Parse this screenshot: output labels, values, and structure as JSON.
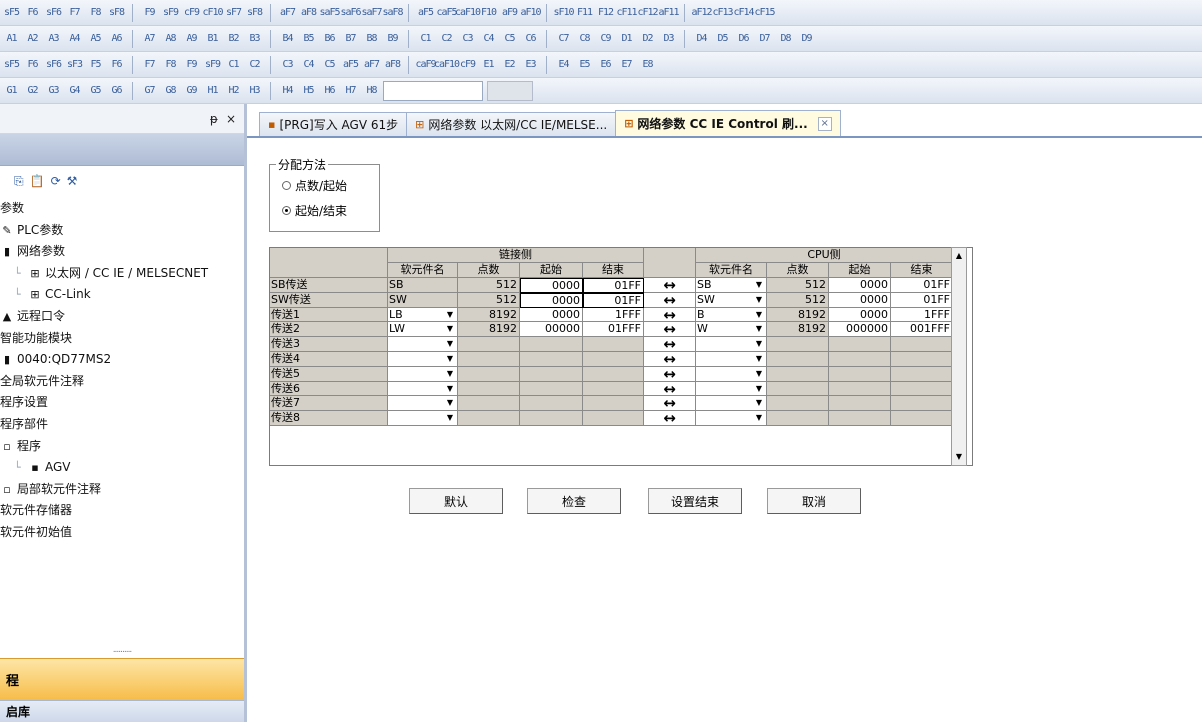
{
  "toolbar": {
    "rows": [
      [
        "sF5",
        "F6",
        "sF6",
        "F7",
        "F8",
        "sF8",
        "F9",
        "sF9",
        "cF9",
        "cF10",
        "sF7",
        "sF8",
        "aF7",
        "aF8",
        "saF5",
        "saF6",
        "saF7",
        "saF8",
        "aF5",
        "caF5",
        "caF10",
        "F10",
        "aF9",
        "aF10",
        "sF10",
        "F11",
        "F12",
        "cF11",
        "cF12",
        "aF11",
        "aF12",
        "cF13",
        "cF14",
        "cF15"
      ],
      [
        "A1",
        "A2",
        "A3",
        "A4",
        "A5",
        "A6",
        "A7",
        "A8",
        "A9",
        "B1",
        "B2",
        "B3",
        "B4",
        "B5",
        "B6",
        "B7",
        "B8",
        "B9",
        "C1",
        "C2",
        "C3",
        "C4",
        "C5",
        "C6",
        "C7",
        "C8",
        "C9",
        "D1",
        "D2",
        "D3",
        "D4",
        "D5",
        "D6",
        "D7",
        "D8",
        "D9"
      ],
      [
        "sF5",
        "F6",
        "sF6",
        "sF3",
        "F5",
        "F6",
        "F7",
        "F8",
        "F9",
        "sF9",
        "C1",
        "C2",
        "C3",
        "C4",
        "C5",
        "aF5",
        "aF7",
        "aF8",
        "caF9",
        "caF10",
        "cF9",
        "E1",
        "E2",
        "E3",
        "E4",
        "E5",
        "E6",
        "E7",
        "E8"
      ],
      [
        "G1",
        "G2",
        "G3",
        "G4",
        "G5",
        "G6",
        "G7",
        "G8",
        "G9",
        "H1",
        "H2",
        "H3",
        "H4",
        "H5",
        "H6",
        "H7",
        "H8"
      ]
    ]
  },
  "nav": {
    "pin": "ᵽ",
    "close": "×",
    "toolbar_icons": [
      "copy-icon",
      "paste-icon",
      "refresh-icon",
      "tools-icon"
    ],
    "items": [
      {
        "label": "参数",
        "indent": 0,
        "icon": ""
      },
      {
        "label": "PLC参数",
        "indent": 0,
        "icon": "✎"
      },
      {
        "label": "网络参数",
        "indent": 0,
        "icon": "▮"
      },
      {
        "label": "以太网 / CC IE / MELSECNET",
        "indent": 1,
        "icon": "⊞"
      },
      {
        "label": "CC-Link",
        "indent": 1,
        "icon": "⊞"
      },
      {
        "label": "远程口令",
        "indent": 0,
        "icon": "▲"
      },
      {
        "label": "智能功能模块",
        "indent": 0,
        "icon": ""
      },
      {
        "label": "0040:QD77MS2",
        "indent": 0,
        "icon": "▮"
      },
      {
        "label": "全局软元件注释",
        "indent": 0,
        "icon": ""
      },
      {
        "label": "程序设置",
        "indent": 0,
        "icon": ""
      },
      {
        "label": "程序部件",
        "indent": 0,
        "icon": ""
      },
      {
        "label": "程序",
        "indent": 0,
        "icon": "▫"
      },
      {
        "label": "AGV",
        "indent": 1,
        "icon": "▪"
      },
      {
        "label": "局部软元件注释",
        "indent": 0,
        "icon": "▫"
      },
      {
        "label": "软元件存储器",
        "indent": 0,
        "icon": ""
      },
      {
        "label": "软元件初始值",
        "indent": 0,
        "icon": ""
      }
    ],
    "splitter": "..........",
    "bottom_label": "程",
    "bottom_next_label": "启库"
  },
  "tabs": [
    {
      "icon": "▪",
      "label": "[PRG]写入 AGV 61步",
      "active": false
    },
    {
      "icon": "⊞",
      "label": "网络参数 以太网/CC IE/MELSE...",
      "active": false
    },
    {
      "icon": "⊞",
      "label": "网络参数 CC IE Control 刷...",
      "active": true,
      "close": "×"
    }
  ],
  "alloc": {
    "legend": "分配方法",
    "options": [
      {
        "label": "点数/起始",
        "selected": false
      },
      {
        "label": "起始/结束",
        "selected": true
      }
    ]
  },
  "grid": {
    "link_side": "链接侧",
    "cpu_side": "CPU侧",
    "col_headers": [
      "软元件名",
      "点数",
      "起始",
      "结束"
    ],
    "rows": [
      {
        "name": "SB传送",
        "link": [
          "SB",
          "512",
          "0000",
          "01FF"
        ],
        "cpu": [
          "SB",
          "512",
          "0000",
          "01FF"
        ]
      },
      {
        "name": "SW传送",
        "link": [
          "SW",
          "512",
          "0000",
          "01FF"
        ],
        "cpu": [
          "SW",
          "512",
          "0000",
          "01FF"
        ]
      },
      {
        "name": "传送1",
        "link": [
          "LB",
          "8192",
          "0000",
          "1FFF"
        ],
        "cpu": [
          "B",
          "8192",
          "0000",
          "1FFF"
        ]
      },
      {
        "name": "传送2",
        "link": [
          "LW",
          "8192",
          "00000",
          "01FFF"
        ],
        "cpu": [
          "W",
          "8192",
          "000000",
          "001FFF"
        ]
      },
      {
        "name": "传送3",
        "link": [
          "",
          "",
          "",
          ""
        ],
        "cpu": [
          "",
          "",
          "",
          ""
        ]
      },
      {
        "name": "传送4",
        "link": [
          "",
          "",
          "",
          ""
        ],
        "cpu": [
          "",
          "",
          "",
          ""
        ]
      },
      {
        "name": "传送5",
        "link": [
          "",
          "",
          "",
          ""
        ],
        "cpu": [
          "",
          "",
          "",
          ""
        ]
      },
      {
        "name": "传送6",
        "link": [
          "",
          "",
          "",
          ""
        ],
        "cpu": [
          "",
          "",
          "",
          ""
        ]
      },
      {
        "name": "传送7",
        "link": [
          "",
          "",
          "",
          ""
        ],
        "cpu": [
          "",
          "",
          "",
          ""
        ]
      },
      {
        "name": "传送8",
        "link": [
          "",
          "",
          "",
          ""
        ],
        "cpu": [
          "",
          "",
          "",
          ""
        ]
      }
    ],
    "arrow": "↔",
    "scroll_up": "▲",
    "scroll_down": "▼",
    "dropdown_glyph": "▼"
  },
  "buttons": {
    "default": "默认",
    "check": "检查",
    "finish": "设置结束",
    "cancel": "取消"
  }
}
